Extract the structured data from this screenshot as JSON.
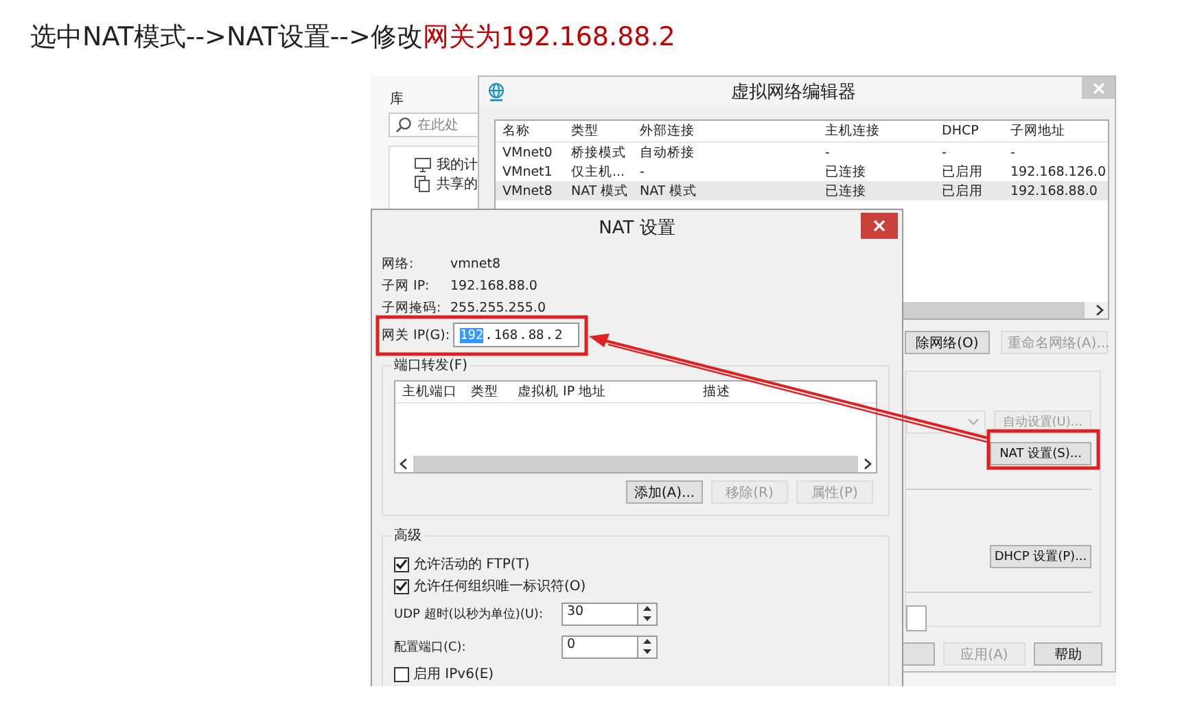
{
  "heading": {
    "text": "选中NAT模式-->NAT设置-->修改",
    "highlight": "网关为192.168.88.2"
  },
  "library_panel": {
    "title": "库",
    "search": {
      "placeholder": "在此处"
    },
    "items": [
      {
        "kind": "computer",
        "label": "我的计"
      },
      {
        "kind": "shared",
        "label": "共享的"
      }
    ]
  },
  "network_editor": {
    "title": "虚拟网络编辑器",
    "columns": [
      "名称",
      "类型",
      "外部连接",
      "主机连接",
      "DHCP",
      "子网地址"
    ],
    "rows": [
      {
        "selected": false,
        "cells": [
          "VMnet0",
          "桥接模式",
          "自动桥接",
          "-",
          "-",
          "-"
        ]
      },
      {
        "selected": false,
        "cells": [
          "VMnet1",
          "仅主机...",
          "-",
          "已连接",
          "已启用",
          "192.168.126.0"
        ]
      },
      {
        "selected": true,
        "cells": [
          "VMnet8",
          "NAT 模式",
          "NAT 模式",
          "已连接",
          "已启用",
          "192.168.88.0"
        ]
      }
    ],
    "network_buttons": [
      {
        "label": "除网络(O)",
        "disabled": false
      },
      {
        "label": "重命名网络(A)...",
        "disabled": true
      }
    ],
    "auto_settings_button": {
      "label": "自动设置(U)...",
      "disabled": true
    },
    "nat_settings_button": {
      "label": "NAT 设置(S)...",
      "disabled": false
    },
    "dhcp_settings_button": {
      "label": "DHCP 设置(P)...",
      "disabled": false
    },
    "footer_buttons": [
      {
        "label": "应用(A)",
        "disabled": true
      },
      {
        "label": "帮助",
        "disabled": false
      }
    ]
  },
  "nat_dialog": {
    "title": "NAT 设置",
    "info": [
      {
        "label": "网络:",
        "value": "vmnet8"
      },
      {
        "label": "子网 IP:",
        "value": "192.168.88.0"
      },
      {
        "label": "子网掩码:",
        "value": "255.255.255.0"
      }
    ],
    "gateway": {
      "label": "网关 IP(G):",
      "separator": ".",
      "segments": [
        {
          "text": "192",
          "selected": true
        },
        {
          "text": "168",
          "selected": false
        },
        {
          "text": "88",
          "selected": false
        },
        {
          "text": "2",
          "selected": false
        }
      ]
    },
    "port_forwarding": {
      "title": "端口转发(F)",
      "columns": [
        "主机端口",
        "类型",
        "虚拟机 IP 地址",
        "描述"
      ],
      "buttons": [
        {
          "label": "添加(A)...",
          "disabled": false
        },
        {
          "label": "移除(R)",
          "disabled": true
        },
        {
          "label": "属性(P)",
          "disabled": true
        }
      ]
    },
    "advanced": {
      "title": "高级",
      "controls": [
        {
          "kind": "checkbox",
          "label": "允许活动的 FTP(T)",
          "checked": true
        },
        {
          "kind": "checkbox",
          "label": "允许任何组织唯一标识符(O)",
          "checked": true
        },
        {
          "kind": "spinner",
          "label": "UDP 超时(以秒为单位)(U):",
          "value": "30"
        },
        {
          "kind": "spinner",
          "label": "配置端口(C):",
          "value": "0"
        },
        {
          "kind": "checkbox",
          "label": "启用 IPv6(E)",
          "checked": false
        }
      ]
    }
  }
}
